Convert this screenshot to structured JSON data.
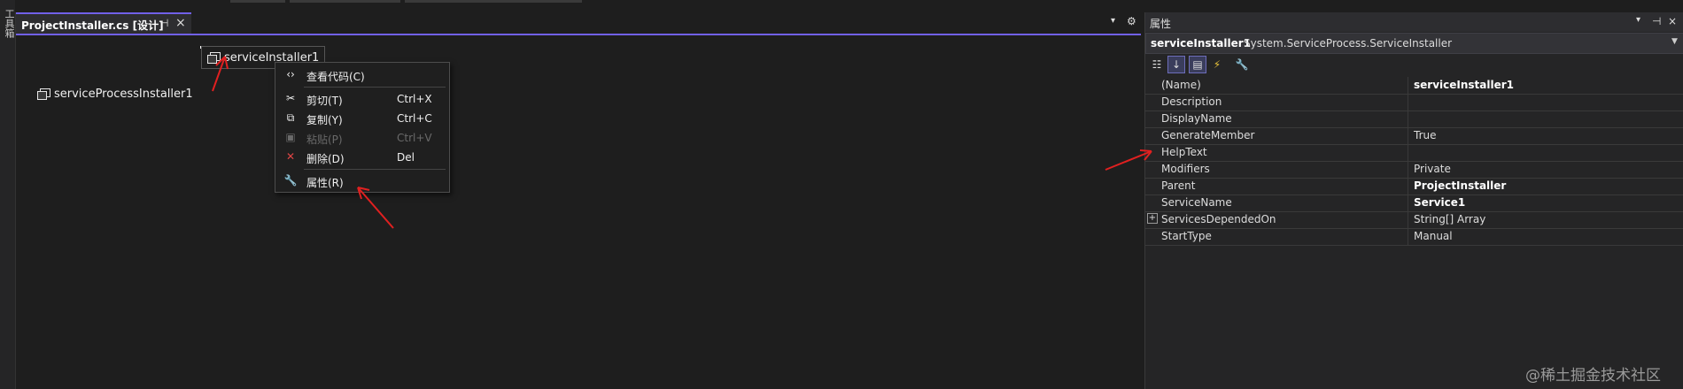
{
  "toolbox_strip": {
    "label": "工具箱"
  },
  "document_tab": {
    "title": "ProjectInstaller.cs [设计]",
    "pin_icon": "pin-icon",
    "close_icon": "close-icon"
  },
  "designer": {
    "components": [
      {
        "name": "serviceInstaller1",
        "icon": "component-icon"
      },
      {
        "name": "serviceProcessInstaller1",
        "icon": "component-icon"
      }
    ]
  },
  "context_menu": {
    "items": [
      {
        "label": "查看代码(C)",
        "shortcut": "",
        "icon": "code-icon",
        "enabled": true
      },
      {
        "label": "剪切(T)",
        "shortcut": "Ctrl+X",
        "icon": "scissors-icon",
        "enabled": true
      },
      {
        "label": "复制(Y)",
        "shortcut": "Ctrl+C",
        "icon": "copy-icon",
        "enabled": true
      },
      {
        "label": "粘贴(P)",
        "shortcut": "Ctrl+V",
        "icon": "paste-icon",
        "enabled": false
      },
      {
        "label": "删除(D)",
        "shortcut": "Del",
        "icon": "delete-icon",
        "enabled": true
      },
      {
        "label": "属性(R)",
        "shortcut": "",
        "icon": "wrench-icon",
        "enabled": true
      }
    ]
  },
  "properties_panel": {
    "title": "属性",
    "object_name": "serviceInstaller1",
    "object_type": "System.ServiceProcess.ServiceInstaller",
    "toolbar_icons": [
      "categorized-icon",
      "alphabetical-icon",
      "properties-icon",
      "events-icon",
      "property-pages-icon"
    ],
    "rows": [
      {
        "name": "(Name)",
        "value": "serviceInstaller1",
        "bold": true,
        "expandable": false
      },
      {
        "name": "Description",
        "value": "",
        "bold": false,
        "expandable": false
      },
      {
        "name": "DisplayName",
        "value": "",
        "bold": false,
        "expandable": false
      },
      {
        "name": "GenerateMember",
        "value": "True",
        "bold": false,
        "expandable": false
      },
      {
        "name": "HelpText",
        "value": "",
        "bold": false,
        "expandable": false
      },
      {
        "name": "Modifiers",
        "value": "Private",
        "bold": false,
        "expandable": false
      },
      {
        "name": "Parent",
        "value": "ProjectInstaller",
        "bold": true,
        "expandable": false
      },
      {
        "name": "ServiceName",
        "value": "Service1",
        "bold": true,
        "expandable": false
      },
      {
        "name": "ServicesDependedOn",
        "value": "String[] Array",
        "bold": false,
        "expandable": true
      },
      {
        "name": "StartType",
        "value": "Manual",
        "bold": false,
        "expandable": false
      }
    ]
  },
  "watermark": "@稀土掘金技术社区",
  "colors": {
    "accent": "#7160e8",
    "annotation": "#e02020",
    "background": "#1e1e1e"
  }
}
